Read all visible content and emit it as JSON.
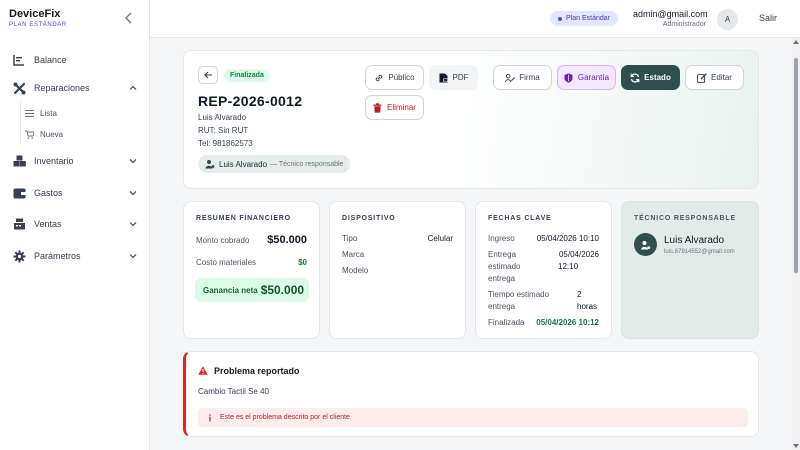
{
  "brand": {
    "name": "DeviceFix",
    "plan": "PLAN ESTÁNDAR"
  },
  "sidebar": {
    "items": [
      {
        "label": "Balance",
        "icon": "chart-icon"
      },
      {
        "label": "Reparaciones",
        "icon": "tools-icon"
      },
      {
        "label": "Inventario",
        "icon": "boxes-icon"
      },
      {
        "label": "Gastos",
        "icon": "wallet-icon"
      },
      {
        "label": "Ventas",
        "icon": "register-icon"
      },
      {
        "label": "Parámetros",
        "icon": "gear-icon"
      }
    ],
    "sub_items": [
      {
        "label": "Lista",
        "icon": "list-icon"
      },
      {
        "label": "Nueva",
        "icon": "cart-plus-icon"
      }
    ]
  },
  "header": {
    "plan_badge": "Plan Estándar",
    "email": "admin@gmail.com",
    "role": "Administrador",
    "avatar": "A",
    "logout": "Salir"
  },
  "repair": {
    "status": "Finalizada",
    "id": "REP-2026-0012",
    "customer_name": "Luis Alvarado",
    "rut": "RUT: Sin RUT",
    "phone": "Tel: 981862573",
    "tech_chip_name": "Luis Alvarado",
    "tech_chip_role": "— Técnico responsable"
  },
  "actions": {
    "publico": "Público",
    "pdf": "PDF",
    "eliminar": "Eliminar",
    "firma": "Firma",
    "garantia": "Garantía",
    "estado": "Estado",
    "editar": "Editar"
  },
  "financial": {
    "title": "RESUMEN FINANCIERO",
    "monto_label": "Monto cobrado",
    "monto_value": "$50.000",
    "costo_label": "Costo materiales",
    "costo_value": "$0",
    "net_label": "Ganancia neta",
    "net_value": "$50.000"
  },
  "device": {
    "title": "DISPOSITIVO",
    "tipo_label": "Tipo",
    "tipo_value": "Celular",
    "marca_label": "Marca",
    "modelo_label": "Modelo"
  },
  "dates": {
    "title": "FECHAS CLAVE",
    "ingreso_label": "Ingreso",
    "ingreso_value": "05/04/2026 10:10",
    "entrega_label_1": "Entrega",
    "entrega_label_2": "estimado",
    "entrega_label_3": "entrega",
    "entrega_value_1": "05/04/2026",
    "entrega_value_2": "12:10",
    "tiempo_label_1": "Tiempo estimado",
    "tiempo_label_2": "entrega",
    "tiempo_value_1": "2",
    "tiempo_value_2": "horas",
    "finalizada_label": "Finalizada",
    "finalizada_value": "05/04/2026 10:12"
  },
  "technician": {
    "title": "TÉCNICO RESPONSABLE",
    "name": "Luis Alvarado",
    "email": "luis.87914552@gmail.com"
  },
  "problem": {
    "title": "Problema reportado",
    "text": "Cambio Tactil Se 40",
    "note": "Este es el problema descrito por el cliente"
  },
  "colors": {
    "accent": "#2f4f4f",
    "success": "#15803d",
    "danger": "#dc2626",
    "purple": "#6b21a8"
  }
}
